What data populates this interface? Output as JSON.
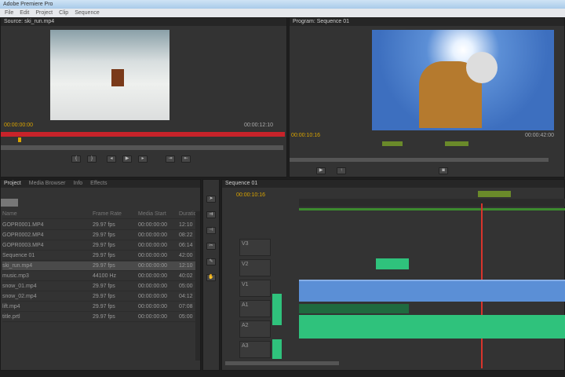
{
  "window": {
    "title": "Adobe Premiere Pro"
  },
  "menu": [
    "File",
    "Edit",
    "Project",
    "Clip",
    "Sequence"
  ],
  "source": {
    "tab": "Source: ski_run.mp4",
    "timecode": "00:00:00:00",
    "duration": "00:00:12:10"
  },
  "program": {
    "tab": "Program: Sequence 01",
    "timecode": "00:00:10:16",
    "duration": "00:00:42:00"
  },
  "project": {
    "tabs": [
      "Project",
      "Media Browser",
      "Info",
      "Effects"
    ],
    "columns": [
      "Name",
      "Frame Rate",
      "Media Start",
      "Duration"
    ],
    "items": [
      {
        "name": "GOPR0001.MP4",
        "fps": "29.97 fps",
        "start": "00:00:00:00",
        "dur": "12:10"
      },
      {
        "name": "GOPR0002.MP4",
        "fps": "29.97 fps",
        "start": "00:00:00:00",
        "dur": "08:22"
      },
      {
        "name": "GOPR0003.MP4",
        "fps": "29.97 fps",
        "start": "00:00:00:00",
        "dur": "06:14"
      },
      {
        "name": "Sequence 01",
        "fps": "29.97 fps",
        "start": "00:00:00:00",
        "dur": "42:00"
      },
      {
        "name": "ski_run.mp4",
        "fps": "29.97 fps",
        "start": "00:00:00:00",
        "dur": "12:10"
      },
      {
        "name": "music.mp3",
        "fps": "44100 Hz",
        "start": "00:00:00:00",
        "dur": "40:02"
      },
      {
        "name": "snow_01.mp4",
        "fps": "29.97 fps",
        "start": "00:00:00:00",
        "dur": "05:00"
      },
      {
        "name": "snow_02.mp4",
        "fps": "29.97 fps",
        "start": "00:00:00:00",
        "dur": "04:12"
      },
      {
        "name": "lift.mp4",
        "fps": "29.97 fps",
        "start": "00:00:00:00",
        "dur": "07:08"
      },
      {
        "name": "title.prtl",
        "fps": "29.97 fps",
        "start": "00:00:00:00",
        "dur": "05:00"
      }
    ]
  },
  "timeline": {
    "tab": "Sequence 01",
    "timecode": "00:00:10:16",
    "tracks": [
      "V3",
      "V2",
      "V1",
      "A1",
      "A2",
      "A3"
    ]
  },
  "colors": {
    "accent": "#d9a300",
    "playhead": "#d8342c",
    "video": "#5b8fd6",
    "audio": "#2fc27c"
  }
}
